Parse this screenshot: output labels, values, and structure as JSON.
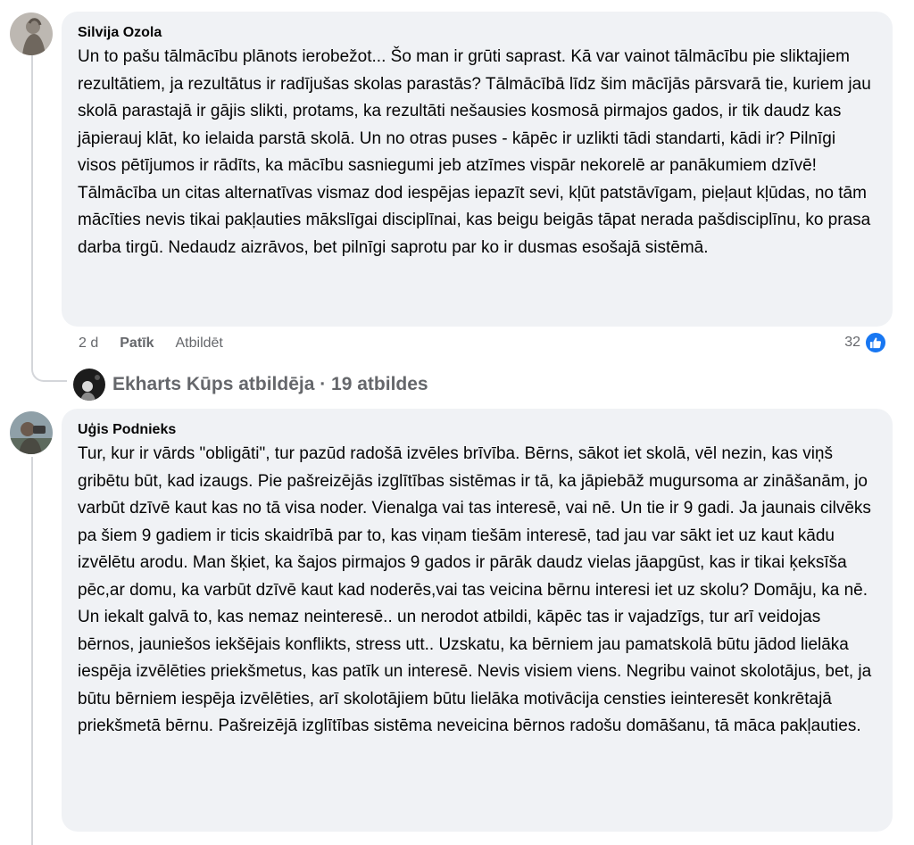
{
  "comments": [
    {
      "author": "Silvija Ozola",
      "text": "Un to pašu tālmācību plānots ierobežot... Šo man ir grūti saprast. Kā var vainot tālmācību pie sliktajiem rezultātiem, ja rezultātus ir radījušas skolas parastās? Tālmācībā līdz šim mācījās pārsvarā tie, kuriem jau skolā parastajā ir gājis slikti, protams, ka rezultāti nešausies kosmosā pirmajos gados, ir tik daudz kas jāpierauj klāt, ko ielaida parstā skolā. Un no otras puses - kāpēc ir uzlikti tādi standarti, kādi ir? Pilnīgi visos pētījumos ir rādīts, ka mācību sasniegumi jeb atzīmes vispār nekorelē ar panākumiem dzīvē! Tālmācība un citas alternatīvas vismaz dod iespējas iepazīt sevi, kļūt patstāvīgam, pieļaut kļūdas, no tām mācīties nevis tikai pakļauties mākslīgai disciplīnai, kas beigu beigās tāpat nerada pašdisciplīnu, ko prasa darba tirgū. Nedaudz aizrāvos, bet pilnīgi saprotu par ko ir dusmas esošajā sistēmā.",
      "time": "2 d",
      "like_label": "Patīk",
      "reply_label": "Atbildēt",
      "reaction_count": "32"
    },
    {
      "author": "Uģis Podnieks",
      "text": "Tur, kur ir vārds \"obligāti\", tur pazūd radošā izvēles brīvība. Bērns, sākot iet skolā, vēl nezin, kas viņš gribētu būt, kad izaugs. Pie pašreizējās izglītības sistēmas ir tā, ka jāpiebāž mugursoma ar zināšanām, jo varbūt dzīvē kaut kas no tā visa noder. Vienalga vai tas interesē, vai nē. Un tie ir 9 gadi. Ja jaunais cilvēks pa šiem 9 gadiem ir ticis skaidrībā par to, kas viņam tiešām interesē, tad jau var sākt iet uz kaut kādu izvēlētu arodu. Man šķiet, ka šajos pirmajos 9 gados ir pārāk daudz vielas jāapgūst, kas ir tikai ķeksīša pēc,ar domu, ka varbūt dzīvē kaut kad noderēs,vai tas veicina bērnu interesi iet uz skolu? Domāju, ka nē. Un iekalt galvā to, kas nemaz neinteresē.. un nerodot atbildi, kāpēc tas ir vajadzīgs, tur arī veidojas bērnos, jauniešos iekšējais konflikts, stress utt.. Uzskatu, ka bērniem jau pamatskolā būtu jādod lielāka iespēja izvēlēties priekšmetus, kas patīk un interesē. Nevis visiem viens. Negribu vainot skolotājus, bet, ja būtu bērniem iespēja izvēlēties, arī skolotājiem būtu lielāka motivācija censties ieinteresēt konkrētajā priekšmetā bērnu. Pašreizējā izglītības sistēma neveicina bērnos radošu domāšanu, tā māca pakļauties."
    }
  ],
  "replies_link": "Ekharts Kūps atbildēja · 19 atbildes",
  "icons": {
    "like_reaction": "like-thumb-icon",
    "avatar_1": "avatar-silvija",
    "avatar_2": "avatar-ugis",
    "avatar_reply": "avatar-ekharts"
  },
  "colors": {
    "bubble": "#f0f2f5",
    "secondary_text": "#65676b",
    "like_blue": "#1877f2"
  }
}
